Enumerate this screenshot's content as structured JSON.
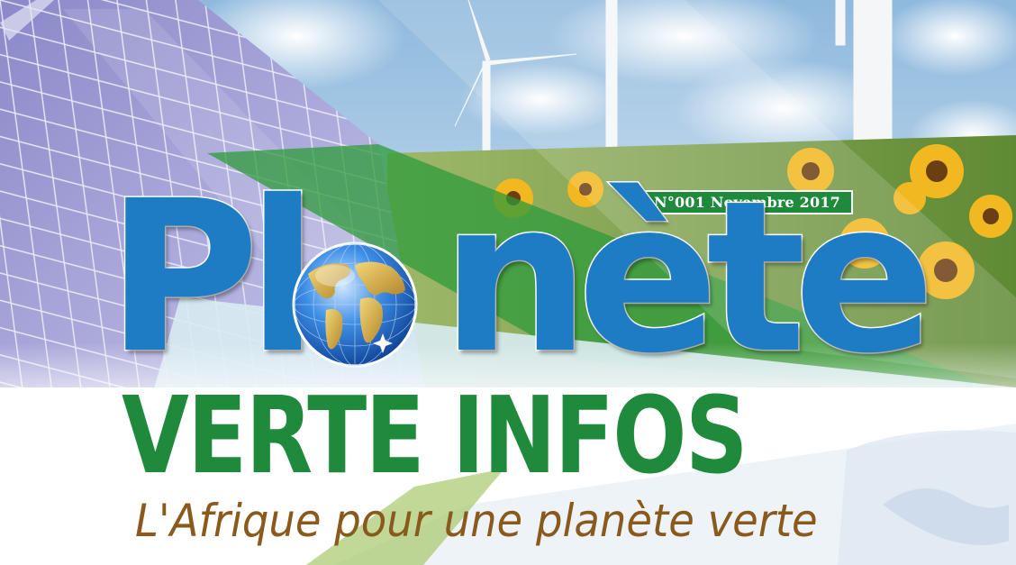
{
  "issue": "N°001 Novembre 2017",
  "title": {
    "part1": "Pl",
    "part2": "nète",
    "line2": "VERTE INFOS"
  },
  "tagline": "L'Afrique pour une planète verte",
  "colors": {
    "title_blue": "#1d7cc4",
    "title_green": "#1f8a3c",
    "tagline_brown": "#8a5a1c",
    "badge_green": "#1f8a3c"
  },
  "icons": [
    "globe-icon",
    "solar-panel",
    "wind-turbine",
    "sunflower"
  ]
}
